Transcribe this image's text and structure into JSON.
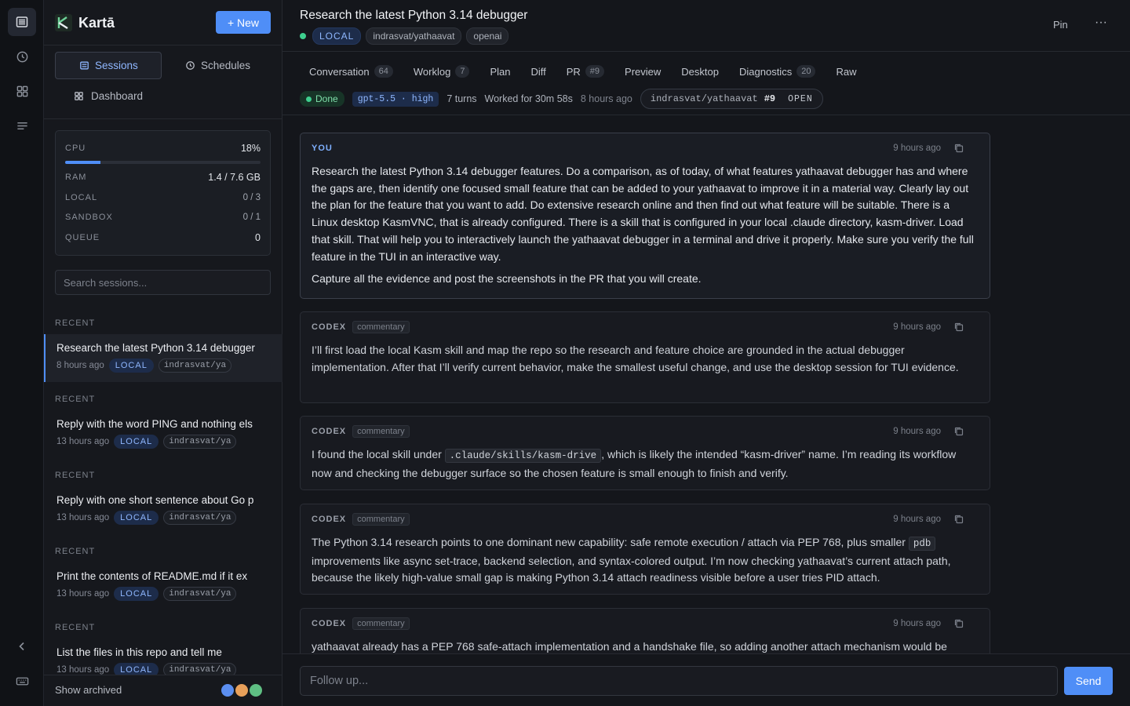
{
  "app": {
    "name": "Kartā",
    "new_label": "+ New"
  },
  "rail": {
    "icons": [
      "sessions-icon",
      "clock-icon",
      "dashboard-icon",
      "list-icon",
      "collapse-icon",
      "keyboard-icon"
    ]
  },
  "nav": {
    "sessions": "Sessions",
    "schedules": "Schedules",
    "dashboard": "Dashboard"
  },
  "metrics": {
    "cpu_label": "CPU",
    "cpu_value": "18%",
    "cpu_fraction": 0.18,
    "ram_label": "RAM",
    "ram_value": "1.4 / 7.6 GB",
    "local_label": "LOCAL",
    "local_value": "0 / 3",
    "sandbox_label": "SANDBOX",
    "sandbox_value": "0 / 1",
    "queue_label": "QUEUE",
    "queue_value": "0"
  },
  "search": {
    "placeholder": "Search sessions..."
  },
  "sessions": [
    {
      "section": "RECENT",
      "title": "Research the latest Python 3.14 debugger",
      "age": "8 hours ago",
      "badge": "LOCAL",
      "repo": "indrasvat/ya",
      "active": true
    },
    {
      "section": "RECENT",
      "title": "Reply with the word PING and nothing els",
      "age": "13 hours ago",
      "badge": "LOCAL",
      "repo": "indrasvat/ya"
    },
    {
      "section": "RECENT",
      "title": "Reply with one short sentence about Go p",
      "age": "13 hours ago",
      "badge": "LOCAL",
      "repo": "indrasvat/ya"
    },
    {
      "section": "RECENT",
      "title": "Print the contents of README.md if it ex",
      "age": "13 hours ago",
      "badge": "LOCAL",
      "repo": "indrasvat/ya"
    },
    {
      "section": "RECENT",
      "title": "List the files in this repo and tell me",
      "age": "13 hours ago",
      "badge": "LOCAL",
      "repo": "indrasvat/ya"
    }
  ],
  "footer": {
    "show_archived": "Show archived",
    "avatar_colors": [
      "#5b8ef0",
      "#e8a05a",
      "#5fbf83"
    ]
  },
  "header": {
    "title": "Research the latest Python 3.14 debugger",
    "tags": [
      "LOCAL",
      "indrasvat/yathaavat",
      "openai"
    ],
    "pin": "Pin",
    "more": "···"
  },
  "tabs": [
    {
      "label": "Conversation",
      "count": "64"
    },
    {
      "label": "Worklog",
      "count": "7"
    },
    {
      "label": "Plan",
      "count": ""
    },
    {
      "label": "Diff",
      "count": ""
    },
    {
      "label": "PR",
      "count": "#9"
    },
    {
      "label": "Preview",
      "count": ""
    },
    {
      "label": "Desktop",
      "count": ""
    },
    {
      "label": "Diagnostics",
      "count": "20"
    },
    {
      "label": "Raw",
      "count": ""
    }
  ],
  "run": {
    "status": "Done",
    "model": "gpt-5.5 · high",
    "turns": "7 turns",
    "worked": "Worked for 30m 58s",
    "ago": "8 hours ago",
    "pr_repo": "indrasvat/yathaavat",
    "pr_number": "#9",
    "pr_state": "OPEN"
  },
  "messages": [
    {
      "who": "YOU",
      "kind": "",
      "time": "9 hours ago",
      "paragraphs": [
        "Research the latest Python 3.14 debugger features. Do a comparison, as of today, of what features yathaavat debugger has and where the gaps are, then identify one focused small feature that can be added to your yathaavat to improve it in a material way. Clearly lay out the plan for the feature that you want to add. Do extensive research online and then find out what feature will be suitable. There is a Linux desktop KasmVNC, that is already configured. There is a skill that is configured in your local .claude directory, kasm-driver. Load that skill. That will help you to interactively launch the yathaavat debugger in a terminal and drive it properly. Make sure you verify the full feature in the TUI in an interactive way.",
        "Capture all the evidence and post the screenshots in the PR that you will create."
      ]
    },
    {
      "who": "CODEX",
      "kind": "commentary",
      "time": "9 hours ago",
      "text": "I’ll first load the local Kasm skill and map the repo so the research and feature choice are grounded in the actual debugger implementation. After that I’ll verify current behavior, make the smallest useful change, and use the desktop session for TUI evidence."
    },
    {
      "who": "CODEX",
      "kind": "commentary",
      "time": "9 hours ago",
      "text_before": "I found the local skill under ",
      "code": ".claude/skills/kasm-drive",
      "text_after": ", which is likely the intended “kasm-driver” name. I’m reading its workflow now and checking the debugger surface so the chosen feature is small enough to finish and verify."
    },
    {
      "who": "CODEX",
      "kind": "commentary",
      "time": "9 hours ago",
      "text_before": "The Python 3.14 research points to one dominant new capability: safe remote execution / attach via PEP 768, plus smaller ",
      "code": "pdb",
      "text_after": " improvements like async set-trace, backend selection, and syntax-colored output. I’m now checking yathaavat’s current attach path, because the likely high-value small gap is making Python 3.14 attach readiness visible before a user tries PID attach."
    },
    {
      "who": "CODEX",
      "kind": "commentary",
      "time": "9 hours ago",
      "text": "yathaavat already has a PEP 768 safe-attach implementation and a handshake file, so adding another attach mechanism would be"
    }
  ],
  "composer": {
    "placeholder": "Follow up...",
    "send": "Send"
  }
}
